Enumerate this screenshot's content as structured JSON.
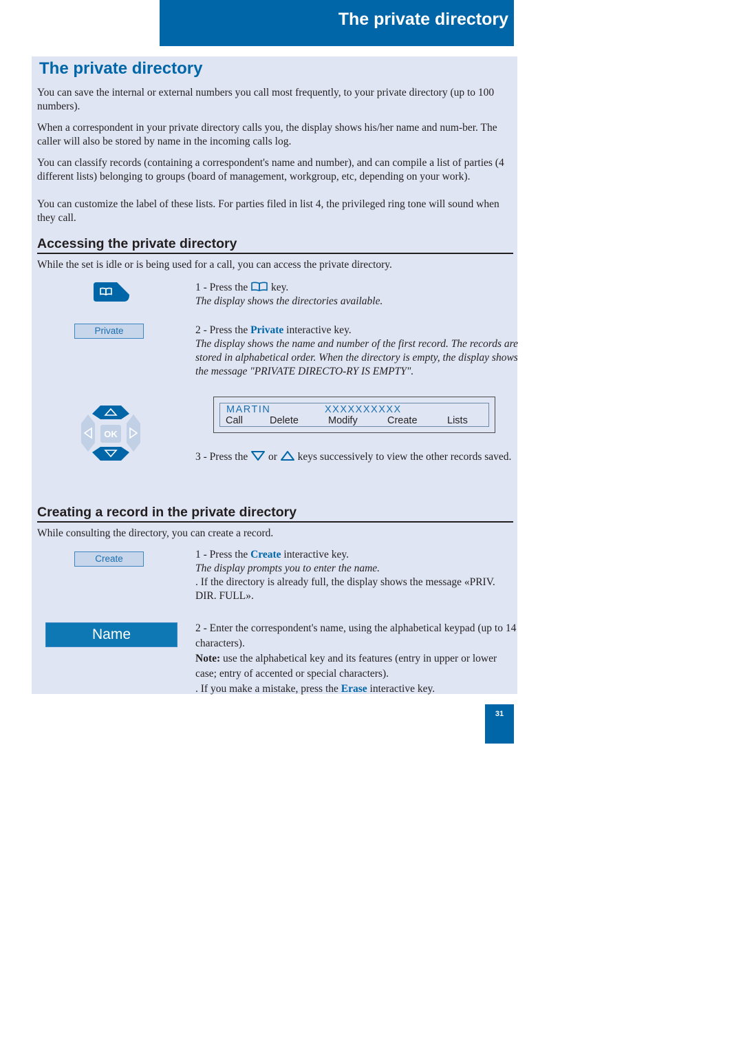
{
  "header": {
    "title": "The private directory"
  },
  "page_title": "The private directory",
  "intro": [
    "You can save the internal or external numbers you call most frequently, to your private directory (up to 100 numbers).",
    "When a correspondent in your private directory calls you, the display shows his/her name and num-ber. The caller will also be stored by name in the incoming calls log.",
    "You can classify records (containing a correspondent's name and number), and can compile a list of parties (4 different lists) belonging to groups (board of management, workgroup, etc, depending on your work).",
    "You can customize the label of these lists. For parties filed in list 4, the privileged ring tone will sound when they call."
  ],
  "section_access": {
    "heading": "Accessing the private directory",
    "lead": "While the set is idle or is being used for a call, you can access the private directory.",
    "step1": {
      "prefix": "1 - Press the",
      "icon": "book-icon",
      "suffix": "key.",
      "note": "The display shows the directories available."
    },
    "step2": {
      "prefix": "2 - Press the",
      "keyword": "Private",
      "suffix": "interactive key.",
      "note": "The display shows the name and number of the first record. The records are stored in alphabetical order. When the directory is empty, the display shows the message \"PRIVATE DIRECTO-RY IS EMPTY\"."
    },
    "softkey_label": "Private",
    "display": {
      "name": "MARTIN",
      "number": "XXXXXXXXXX",
      "keys": [
        "Call",
        "Delete",
        "Modify",
        "Create",
        "Lists"
      ]
    },
    "nav_pad": {
      "center_label": "OK",
      "icons": [
        "arrow-up-icon",
        "arrow-down-icon",
        "arrow-left-icon",
        "arrow-right-icon"
      ]
    },
    "step3": {
      "prefix": "3 - Press the",
      "icon_down": "arrow-down-icon",
      "or": "or",
      "icon_up": "arrow-up-icon",
      "suffix": "keys successively to view the other records saved."
    }
  },
  "section_create": {
    "heading": "Creating a record in the private directory",
    "lead": "While consulting the directory, you can create a record.",
    "softkey_label": "Create",
    "name_field": "Name",
    "step1": {
      "prefix": "1 - Press the",
      "keyword": "Create",
      "suffix": "interactive key.",
      "note": "The display prompts you to enter the name.",
      "extra": ". If the directory is already full, the display shows the message «PRIV. DIR. FULL»."
    },
    "step2": {
      "text": "2 - Enter the correspondent's name, using the alphabetical keypad (up to 14 characters).",
      "note_label": "Note:",
      "note_text": "use the alphabetical key and its features (entry in upper or lower case; entry of accented or special characters).",
      "erase_prefix": ". If you make a mistake, press the",
      "erase_keyword": "Erase",
      "erase_suffix": "interactive key."
    }
  },
  "page_number": "31",
  "colors": {
    "brand_blue": "#0066a8",
    "panel_bg": "#dfe5f2",
    "softkey_bg": "#c7d6ea"
  }
}
